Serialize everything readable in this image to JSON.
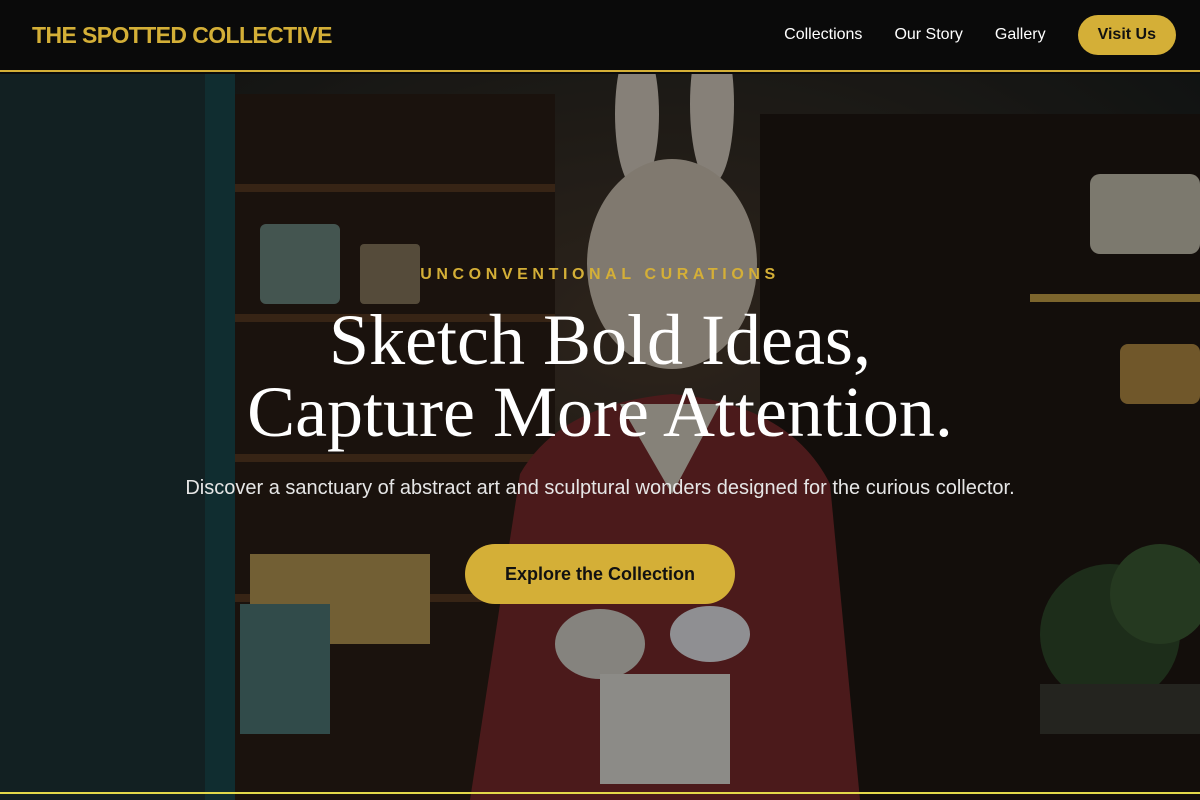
{
  "nav": {
    "brand": "THE SPOTTED COLLECTIVE",
    "links": [
      "Collections",
      "Our Story",
      "Gallery"
    ],
    "cta_label": "Visit Us"
  },
  "hero": {
    "eyebrow": "UNCONVENTIONAL CURATIONS",
    "headline_line1": "Sketch Bold Ideas,",
    "headline_line2": "Capture More Attention.",
    "subtitle": "Discover a sanctuary of abstract art and sculptural wonders designed for the curious collector.",
    "cta_label": "Explore the Collection",
    "background_image": "shop interior with rabbit sculpture holding a teacup"
  },
  "colors": {
    "accent": "#d4af37",
    "nav_bg": "#0a0a0a",
    "text_light": "#ffffff"
  }
}
